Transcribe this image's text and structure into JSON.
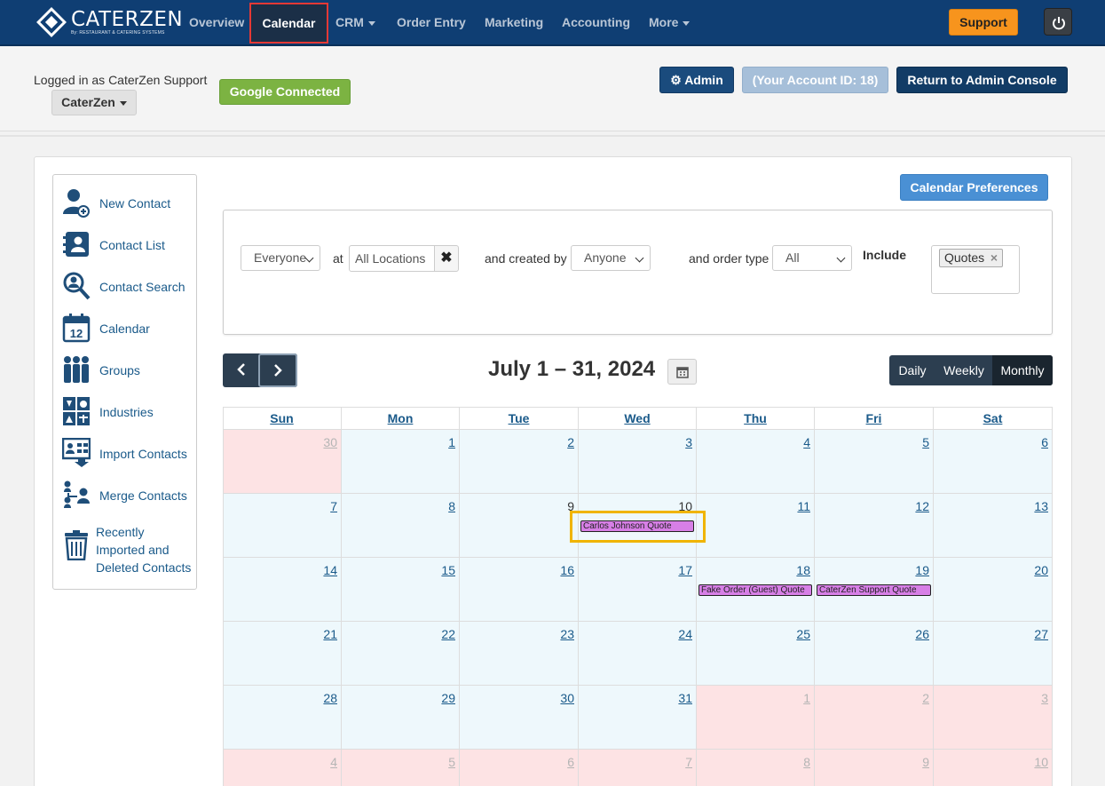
{
  "app": {
    "logo_name": "CATERZEN",
    "logo_tagline": "By: RESTAURANT & CATERING SYSTEMS"
  },
  "topnav": {
    "items": [
      {
        "label": "Overview",
        "dropdown": false
      },
      {
        "label": "Calendar",
        "active": true
      },
      {
        "label": "CRM",
        "dropdown": true
      },
      {
        "label": "Order Entry",
        "dropdown": false
      },
      {
        "label": "Marketing",
        "dropdown": false
      },
      {
        "label": "Accounting",
        "dropdown": false
      },
      {
        "label": "More",
        "dropdown": true
      }
    ],
    "support_label": "Support",
    "power_icon": "power-icon"
  },
  "header": {
    "logged_in_text": "Logged in as CaterZen Support",
    "account_select": "CaterZen",
    "google_label": "Google Connected",
    "admin_label": "Admin",
    "account_id_label": "(Your Account ID: 18)",
    "return_label": "Return to Admin Console"
  },
  "sidebar": {
    "items": [
      {
        "label": "New Contact",
        "icon": "new-contact-icon"
      },
      {
        "label": "Contact List",
        "icon": "contact-list-icon"
      },
      {
        "label": "Contact Search",
        "icon": "contact-search-icon"
      },
      {
        "label": "Calendar",
        "icon": "calendar-icon",
        "icon_text": "12"
      },
      {
        "label": "Groups",
        "icon": "groups-icon"
      },
      {
        "label": "Industries",
        "icon": "industries-icon"
      },
      {
        "label": "Import Contacts",
        "icon": "import-contacts-icon"
      },
      {
        "label": "Merge Contacts",
        "icon": "merge-contacts-icon"
      },
      {
        "label": "Recently Imported and Deleted Contacts",
        "lines": [
          "Recently",
          "Imported and",
          "Deleted Contacts"
        ],
        "icon": "trash-icon"
      }
    ]
  },
  "calendar": {
    "preferences_label": "Calendar Preferences",
    "filters": {
      "who": "Everyone",
      "at_label": "at",
      "location": "All Locations",
      "created_by_label": "and created by",
      "created_by": "Anyone",
      "order_type_label": "and order type",
      "order_type": "All",
      "include_label": "Include",
      "include_tags": [
        "Quotes"
      ]
    },
    "title": "July 1 – 31, 2024",
    "views": [
      "Daily",
      "Weekly",
      "Monthly"
    ],
    "active_view": "Monthly",
    "weekdays": [
      "Sun",
      "Mon",
      "Tue",
      "Wed",
      "Thu",
      "Fri",
      "Sat"
    ],
    "weeks": [
      [
        {
          "d": "30",
          "o": true
        },
        {
          "d": "1"
        },
        {
          "d": "2"
        },
        {
          "d": "3"
        },
        {
          "d": "4"
        },
        {
          "d": "5"
        },
        {
          "d": "6"
        }
      ],
      [
        {
          "d": "7"
        },
        {
          "d": "8"
        },
        {
          "d": "9",
          "plain": true
        },
        {
          "d": "10",
          "plain": true
        },
        {
          "d": "11"
        },
        {
          "d": "12"
        },
        {
          "d": "13"
        }
      ],
      [
        {
          "d": "14"
        },
        {
          "d": "15"
        },
        {
          "d": "16"
        },
        {
          "d": "17"
        },
        {
          "d": "18"
        },
        {
          "d": "19"
        },
        {
          "d": "20"
        }
      ],
      [
        {
          "d": "21"
        },
        {
          "d": "22"
        },
        {
          "d": "23"
        },
        {
          "d": "24"
        },
        {
          "d": "25"
        },
        {
          "d": "26"
        },
        {
          "d": "27"
        }
      ],
      [
        {
          "d": "28"
        },
        {
          "d": "29"
        },
        {
          "d": "30"
        },
        {
          "d": "31"
        },
        {
          "d": "1",
          "o": true
        },
        {
          "d": "2",
          "o": true
        },
        {
          "d": "3",
          "o": true
        }
      ],
      [
        {
          "d": "4",
          "o": true
        },
        {
          "d": "5",
          "o": true
        },
        {
          "d": "6",
          "o": true
        },
        {
          "d": "7",
          "o": true
        },
        {
          "d": "8",
          "o": true
        },
        {
          "d": "9",
          "o": true
        },
        {
          "d": "10",
          "o": true
        }
      ]
    ],
    "events": [
      {
        "label": "Carlos Johnson Quote",
        "week": 1,
        "day": 3
      },
      {
        "label": "Fake Order (Guest) Quote",
        "week": 2,
        "day": 4
      },
      {
        "label": "CaterZen Support Quote",
        "week": 2,
        "day": 5
      }
    ],
    "colors": {
      "event": "#d77fe6",
      "highlight": "#f0b400",
      "arrow": "#e8664f"
    }
  }
}
